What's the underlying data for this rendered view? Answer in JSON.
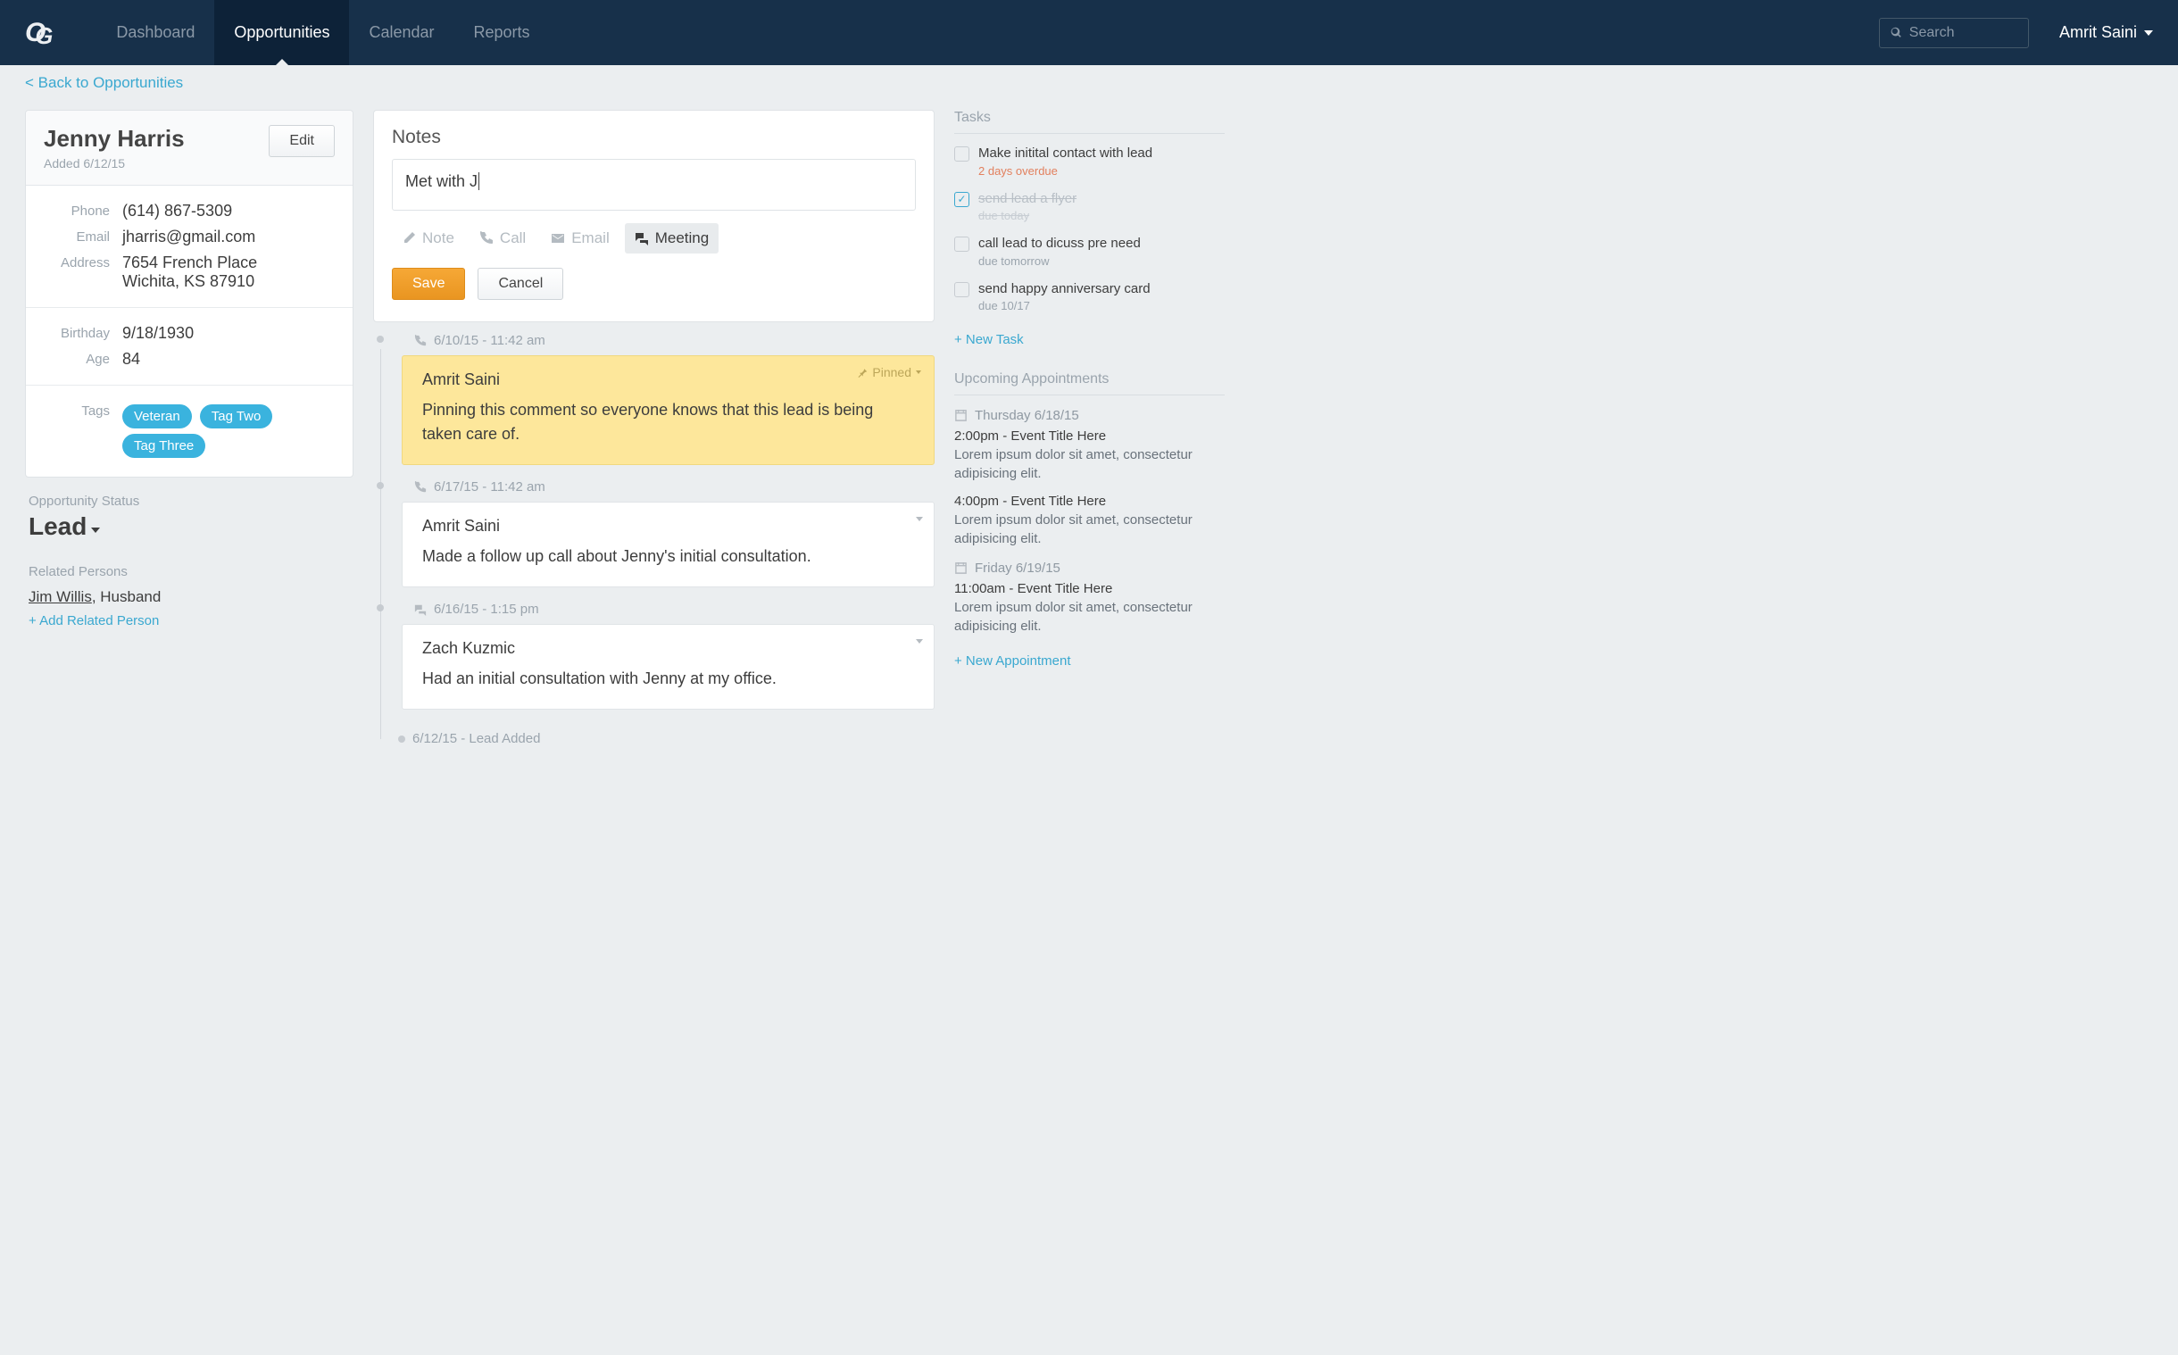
{
  "nav": {
    "logo": "OG",
    "tabs": [
      "Dashboard",
      "Opportunities",
      "Calendar",
      "Reports"
    ],
    "activeTab": 1,
    "searchPlaceholder": "Search",
    "userName": "Amrit Saini"
  },
  "backLink": "< Back to Opportunities",
  "contact": {
    "name": "Jenny Harris",
    "added": "Added 6/12/15",
    "editLabel": "Edit",
    "phoneLabel": "Phone",
    "phone": "(614) 867-5309",
    "emailLabel": "Email",
    "email": "jharris@gmail.com",
    "addressLabel": "Address",
    "address1": "7654 French Place",
    "address2": "Wichita, KS 87910",
    "birthdayLabel": "Birthday",
    "birthday": "9/18/1930",
    "ageLabel": "Age",
    "age": "84",
    "tagsLabel": "Tags",
    "tags": [
      "Veteran",
      "Tag Two",
      "Tag Three"
    ]
  },
  "status": {
    "label": "Opportunity Status",
    "value": "Lead"
  },
  "related": {
    "title": "Related Persons",
    "personName": "Jim Willis",
    "personRel": ", Husband",
    "addLabel": "+ Add Related Person"
  },
  "notes": {
    "title": "Notes",
    "draft": "Met with J",
    "types": {
      "note": "Note",
      "call": "Call",
      "email": "Email",
      "meeting": "Meeting"
    },
    "save": "Save",
    "cancel": "Cancel"
  },
  "timeline": [
    {
      "meta": "6/10/15 - 11:42 am",
      "icon": "phone",
      "author": "Amrit Saini",
      "body": "Pinning this comment so everyone knows that this lead is being taken care of.",
      "pinned": true,
      "pinLabel": "Pinned"
    },
    {
      "meta": "6/17/15 - 11:42 am",
      "icon": "phone",
      "author": "Amrit Saini",
      "body": "Made a follow up call about Jenny's initial consultation."
    },
    {
      "meta": "6/16/15 - 1:15 pm",
      "icon": "meeting",
      "author": "Zach Kuzmic",
      "body": "Had an initial consultation with Jenny at my office."
    }
  ],
  "timelineEnd": "6/12/15  -  Lead Added",
  "tasks": {
    "title": "Tasks",
    "items": [
      {
        "title": "Make initital contact with lead",
        "sub": "2 days overdue",
        "overdue": true,
        "done": false
      },
      {
        "title": "send lead a flyer",
        "sub": "due today",
        "done": true
      },
      {
        "title": "call lead to dicuss pre need",
        "sub": "due tomorrow",
        "done": false
      },
      {
        "title": "send happy anniversary card",
        "sub": "due 10/17",
        "done": false
      }
    ],
    "addLabel": "+ New Task"
  },
  "appts": {
    "title": "Upcoming Appointments",
    "days": [
      {
        "date": "Thursday 6/18/15",
        "items": [
          {
            "t": "2:00pm - Event Title Here",
            "d": "Lorem ipsum dolor sit amet, consectetur adipisicing elit."
          },
          {
            "t": "4:00pm - Event Title Here",
            "d": "Lorem ipsum dolor sit amet, consectetur adipisicing elit."
          }
        ]
      },
      {
        "date": "Friday 6/19/15",
        "items": [
          {
            "t": "11:00am - Event Title Here",
            "d": "Lorem ipsum dolor sit amet, consectetur adipisicing elit."
          }
        ]
      }
    ],
    "addLabel": "+ New Appointment"
  }
}
